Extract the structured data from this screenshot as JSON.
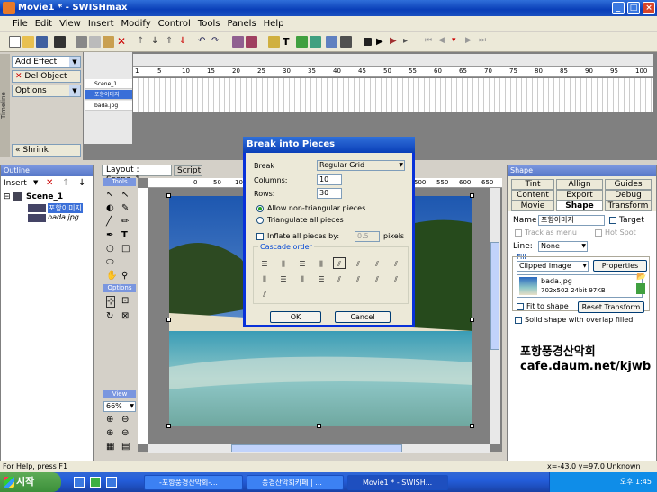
{
  "window": {
    "title": "Movie1 * - SWISHmax",
    "min": "_",
    "max": "□",
    "close": "×"
  },
  "menu": [
    "File",
    "Edit",
    "View",
    "Insert",
    "Modify",
    "Control",
    "Tools",
    "Panels",
    "Help"
  ],
  "effects": {
    "add_effect": "Add Effect",
    "del_object": "Del Object",
    "options": "Options",
    "shrink": "Shrink",
    "side_label": "Timeline"
  },
  "timeline": {
    "scene": "Scene_1",
    "rows": [
      "포항이미지",
      "bada.jpg"
    ],
    "ruler": [
      "1",
      "5",
      "10",
      "15",
      "20",
      "25",
      "30",
      "35",
      "40",
      "45",
      "50",
      "55",
      "60",
      "65",
      "70",
      "75",
      "80",
      "85",
      "90",
      "95",
      "100"
    ]
  },
  "outline": {
    "title": "Outline",
    "insert": "Insert",
    "scene": "Scene_1",
    "items": [
      "포항이미지",
      "bada.jpg"
    ]
  },
  "layout": {
    "tab_layout": "Layout : Scene_1",
    "tab_script": "Script",
    "tools_label": "Tools",
    "options_label": "Options",
    "view_label": "View",
    "zoom": "66%",
    "hruler": [
      "0",
      "50",
      "100",
      "150",
      "200",
      "250",
      "300",
      "350",
      "400",
      "450",
      "500",
      "550",
      "600",
      "650",
      "700",
      "750"
    ]
  },
  "shape": {
    "title": "Shape",
    "tabs_row1": [
      "Tint",
      "Allign",
      "Guides"
    ],
    "tabs_row2": [
      "Content",
      "Export",
      "Debug"
    ],
    "tabs_row3": [
      "Movie",
      "Shape",
      "Transform"
    ],
    "name_label": "Name",
    "name_value": "포항이미지",
    "target": "Target",
    "track_as_menu": "Track as menu",
    "hot_spot": "Hot Spot",
    "line_label": "Line:",
    "line_value": "None",
    "fill_label": "Fill",
    "fill_value": "Clipped Image",
    "properties": "Properties",
    "image_name": "bada.jpg",
    "image_info": "702x502 24bit 97KB",
    "fit_to_shape": "Fit to shape",
    "reset_transform": "Reset Transform",
    "solid_shape": "Solid shape with overlap filled"
  },
  "watermark": {
    "line1": "포항풍경산악회",
    "line2": "cafe.daum.net/kjwb"
  },
  "dialog": {
    "title": "Break into Pieces",
    "break_label": "Break",
    "break_value": "Regular Grid",
    "columns_label": "Columns:",
    "columns_value": "10",
    "rows_label": "Rows:",
    "rows_value": "30",
    "radio1": "Allow non-triangular pieces",
    "radio2": "Triangulate all pieces",
    "inflate_label": "Inflate all pieces by:",
    "inflate_value": "0.5",
    "inflate_unit": "pixels",
    "cascade_label": "Cascade order",
    "ok": "OK",
    "cancel": "Cancel"
  },
  "status": {
    "help": "For Help, press F1",
    "coords": "x=-43.0 y=97.0  Unknown Size"
  },
  "taskbar": {
    "start": "시작",
    "items": [
      "-포항풍경산악회-...",
      "풍경산악회카페 | ...",
      "Movie1 * - SWISH..."
    ],
    "clock": "오후 1:45"
  }
}
